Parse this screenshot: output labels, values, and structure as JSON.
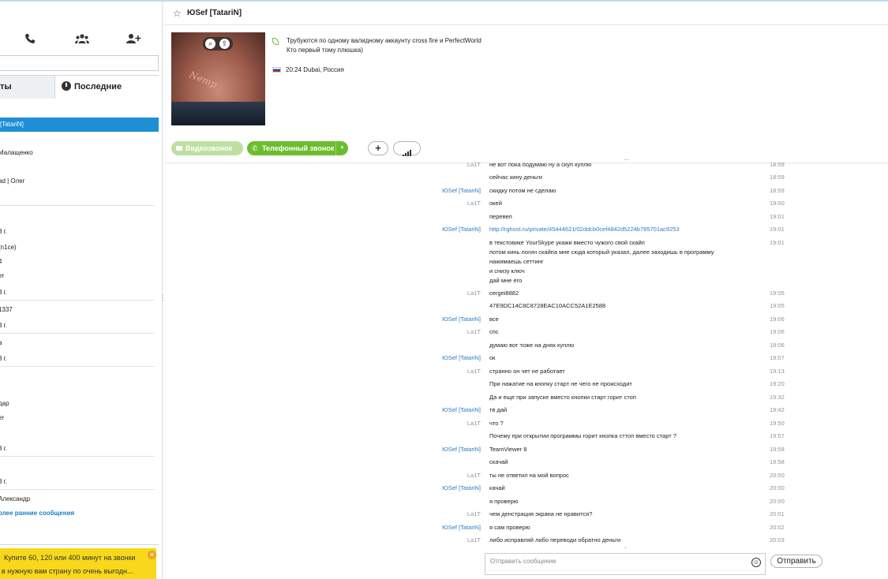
{
  "sidebar": {
    "search_placeholder": "",
    "tabs": {
      "contacts": "ты",
      "recent": "Последние"
    },
    "selected_item": "[TatariN]",
    "items": [
      "Малащенко",
      "ad | Олег",
      "3 г.",
      "(n1ce)",
      "4",
      "er",
      "3 г.",
      "1337",
      "3 г.",
      "а",
      "3 г.",
      "дар",
      "er",
      "3 г.",
      "3 г.",
      "Александр"
    ],
    "earlier_link": "олее ранние сообщения",
    "promo": {
      "line1": "Купите 60, 120 или 400 минут на звонки",
      "line2": "в нужную вам страну по очень выгодн..."
    }
  },
  "header": {
    "title": "ЮSef [TatariN]"
  },
  "profile": {
    "avatar_text": "Nemp",
    "mood_line1": "Трубуются по одному валидному аккаунту  cross fire и PerfectWorld",
    "mood_line2": "Кто первый тому плюшка)",
    "location": "20:24 Dubai, Россия"
  },
  "call_bar": {
    "video_label": "Видеозвонок",
    "phone_label": "Телефонный звонок",
    "dropdown_glyph": "▾",
    "add_glyph": "+"
  },
  "chat": {
    "more_indicator": "...",
    "messages": [
      {
        "author": "La1T",
        "author_is_peer": false,
        "text": "не вот пока подумаю ну а скуп куплю",
        "time": "18:59"
      },
      {
        "author": "",
        "author_is_peer": false,
        "text": "сейчас кину деньги",
        "time": "18:59"
      },
      {
        "author": "ЮSef [TatariN]",
        "author_is_peer": true,
        "text": "скидку потом не сделаю",
        "time": "18:59"
      },
      {
        "author": "La1T",
        "author_is_peer": false,
        "text": "окей",
        "time": "19:00"
      },
      {
        "author": "",
        "author_is_peer": false,
        "text": "перевел",
        "time": "19:01"
      },
      {
        "author": "ЮSef [TatariN]",
        "author_is_peer": true,
        "text": "http://rghost.ru/private/45444621/02ddcb0cef4842d5224b785701ac9253",
        "time": "19:01",
        "is_link": true
      },
      {
        "author": "",
        "author_is_peer": false,
        "lines": [
          "в текстовике YourSkype укажи вместо чужого свой скайп",
          "потом кинь логин скайпа мне сюда который указал, далее заходишь в программу",
          "нажимаешь сеттинг",
          "и снизу ключ",
          "дай мне его"
        ],
        "time": "19:01"
      },
      {
        "author": "La1T",
        "author_is_peer": false,
        "text": "cergei8882",
        "time": "19:05"
      },
      {
        "author": "",
        "author_is_peer": false,
        "text": "47E9DC14C8C8728EAC10ACC52A1E2588",
        "time": "19:05"
      },
      {
        "author": "ЮSef [TatariN]",
        "author_is_peer": true,
        "text": "все",
        "time": "19:06"
      },
      {
        "author": "La1T",
        "author_is_peer": false,
        "text": "спс",
        "time": "19:06"
      },
      {
        "author": "",
        "author_is_peer": false,
        "text": "думаю вот тоже на днях куплю",
        "time": "19:06"
      },
      {
        "author": "ЮSef [TatariN]",
        "author_is_peer": true,
        "text": "ок",
        "time": "19:07"
      },
      {
        "author": "La1T",
        "author_is_peer": false,
        "text": "странно он чет не работает",
        "time": "19:13"
      },
      {
        "author": "",
        "author_is_peer": false,
        "text": "При нажатие на кнопку старт не чего не происходит",
        "time": "19:20"
      },
      {
        "author": "",
        "author_is_peer": false,
        "text": "Да и еще при запуске вместо кнопки старт горит стоп",
        "time": "19:32"
      },
      {
        "author": "ЮSef [TatariN]",
        "author_is_peer": true,
        "text": "тв дай",
        "time": "19:42"
      },
      {
        "author": "La1T",
        "author_is_peer": false,
        "text": "что ?",
        "time": "19:50"
      },
      {
        "author": "",
        "author_is_peer": false,
        "text": "Почему при открытии программы горит кнопка сттоп вместо старт ?",
        "time": "19:57"
      },
      {
        "author": "ЮSef [TatariN]",
        "author_is_peer": true,
        "text": "TeamViewer 8",
        "time": "19:58"
      },
      {
        "author": "",
        "author_is_peer": false,
        "text": "скачай",
        "time": "19:58"
      },
      {
        "author": "La1T",
        "author_is_peer": false,
        "text": "ты не ответил на мой вопрос",
        "time": "20:00"
      },
      {
        "author": "ЮSef [TatariN]",
        "author_is_peer": true,
        "text": "качай",
        "time": "20:00"
      },
      {
        "author": "",
        "author_is_peer": false,
        "text": "я проверю",
        "time": "20:00"
      },
      {
        "author": "La1T",
        "author_is_peer": false,
        "text": "чем денстрация экрана не нравится?",
        "time": "20:01"
      },
      {
        "author": "ЮSef [TatariN]",
        "author_is_peer": true,
        "text": "я сам проверю",
        "time": "20:02"
      },
      {
        "author": "La1T",
        "author_is_peer": false,
        "text": "либо исправляй либо переводи обратно деньги",
        "time": "20:03"
      }
    ]
  },
  "composer": {
    "placeholder": "Отправить сообщение",
    "send_label": "Отправить",
    "emoji_glyph": "☺"
  },
  "colors": {
    "accent_blue": "#1e8fd6",
    "call_green": "#6cbd2e",
    "promo_yellow": "#f7d81a",
    "peer_name": "#2c7cc2"
  }
}
